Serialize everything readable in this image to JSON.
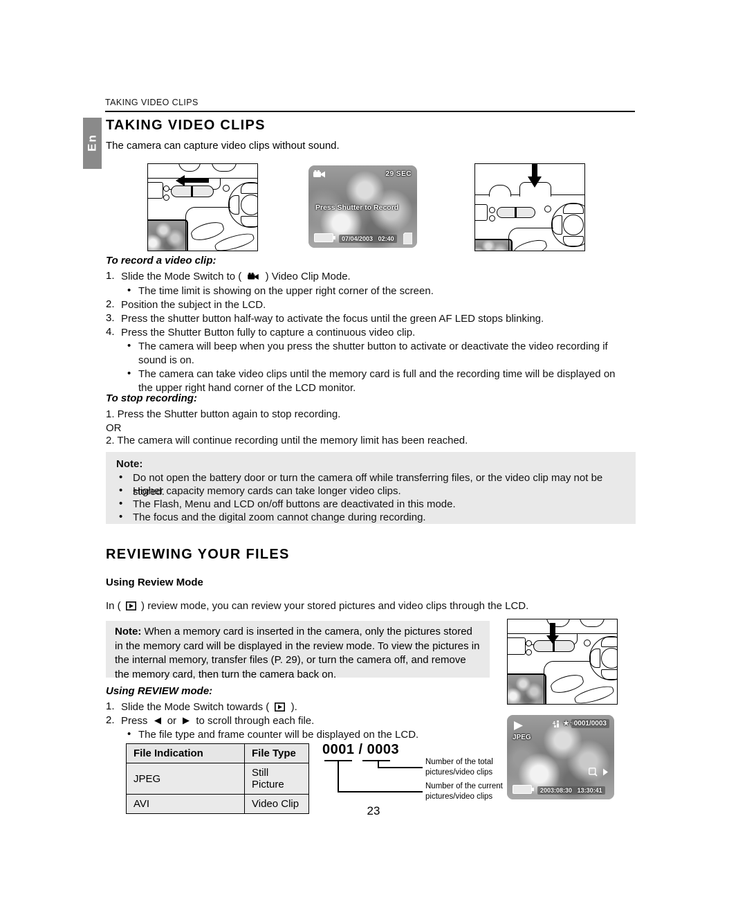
{
  "running_head": "TAKING VIDEO CLIPS",
  "side_tab": "En",
  "page_number": "23",
  "section1": {
    "title": "TAKING VIDEO CLIPS",
    "intro": "The camera can capture video clips without sound.",
    "record_heading": "To record a video clip:",
    "record_steps": [
      {
        "num": "1.",
        "text": "Slide the Mode Switch to (",
        "text2": ") Video Clip Mode.",
        "icon": "video-camera-icon"
      },
      {
        "num": "2.",
        "text": "Position the subject in the LCD."
      },
      {
        "num": "3.",
        "text": "Press the shutter button half-way to activate the focus until the green AF LED stops blinking."
      },
      {
        "num": "4.",
        "text": "Press the Shutter Button fully to capture a continuous video clip."
      }
    ],
    "bullet_after_1": "The time limit is showing on the upper right corner of the screen.",
    "bullets_after_4": [
      "The camera will beep when you press the shutter button to activate or deactivate the video recording if sound is on.",
      "The camera can take video clips until the memory card is full and the recording time will be displayed on the upper right hand corner of the LCD monitor."
    ],
    "stop_heading": "To stop recording:",
    "stop_lines": [
      "1. Press the Shutter button again to stop recording.",
      "OR",
      "2. The camera will continue recording until the memory limit has been reached."
    ],
    "note": {
      "title": "Note:",
      "bullets": [
        "Do not open the battery door or turn the camera off while transferring files, or the video clip may not be stored.",
        "Higher capacity memory cards can take longer video clips.",
        "The Flash, Menu and LCD on/off buttons are deactivated in this mode.",
        "The focus and the digital zoom cannot change during recording."
      ]
    }
  },
  "section2": {
    "title": "REVIEWING YOUR FILES",
    "subhead": "Using Review Mode",
    "intro_a": "In (",
    "intro_b": ") review mode, you can review your stored pictures and video clips through the LCD.",
    "note": {
      "label": "Note:",
      "text": "When a memory card is inserted in the camera, only the pictures stored in the memory card will be displayed in the review mode. To view the pictures in the internal memory, transfer files (P. 29), or turn the camera off, and remove the memory card, then turn the camera back on."
    },
    "using_heading": "Using REVIEW mode:",
    "using_steps": [
      {
        "num": "1.",
        "a": "Slide the Mode Switch towards (",
        "b": ")."
      },
      {
        "num": "2.",
        "a": "Press",
        "mid": "or",
        "b": "to scroll through each file."
      }
    ],
    "using_bullet": "The file type and frame counter will be displayed on the LCD."
  },
  "table": {
    "headers": [
      "File Indication",
      "File Type"
    ],
    "rows": [
      [
        "JPEG",
        "Still Picture"
      ],
      [
        "AVI",
        "Video Clip"
      ]
    ]
  },
  "counter_diagram": {
    "value": "0001 / 0003",
    "label_total_l1": "Number of the total",
    "label_total_l2": "pictures/video clips",
    "label_current_l1": "Number of the current",
    "label_current_l2": "pictures/video clips"
  },
  "figures": {
    "cam1": {
      "name": "camera-mode-switch-left",
      "arrow": "arrow-left"
    },
    "cam2": {
      "name": "camera-shutter-press",
      "arrow": "arrow-down"
    },
    "cam3": {
      "name": "camera-mode-switch-review",
      "arrow": "arrow-down"
    },
    "lcd_record": {
      "mode_icon": "video-camera-icon",
      "time_limit": "29 SEC",
      "message": "Press Shutter to Record",
      "date": "07/04/2003",
      "time": "02:40",
      "battery_icon": "battery-icon",
      "card_icon": "memory-card-icon"
    },
    "lcd_review": {
      "play_icon": "play-icon",
      "file_type": "JPEG",
      "quality_icon": "resolution-icon",
      "stars": "★★★",
      "counter": "0001/0003",
      "date": "2003:08:30",
      "time": "13:30:41",
      "battery_icon": "battery-icon",
      "zoom_icon": "magnifier-icon"
    }
  },
  "colors": {
    "tab_grey": "#8a8a8a",
    "note_grey": "#e9e9e9",
    "table_head": "#e6e6e6",
    "table_cell": "#eaeaea"
  }
}
